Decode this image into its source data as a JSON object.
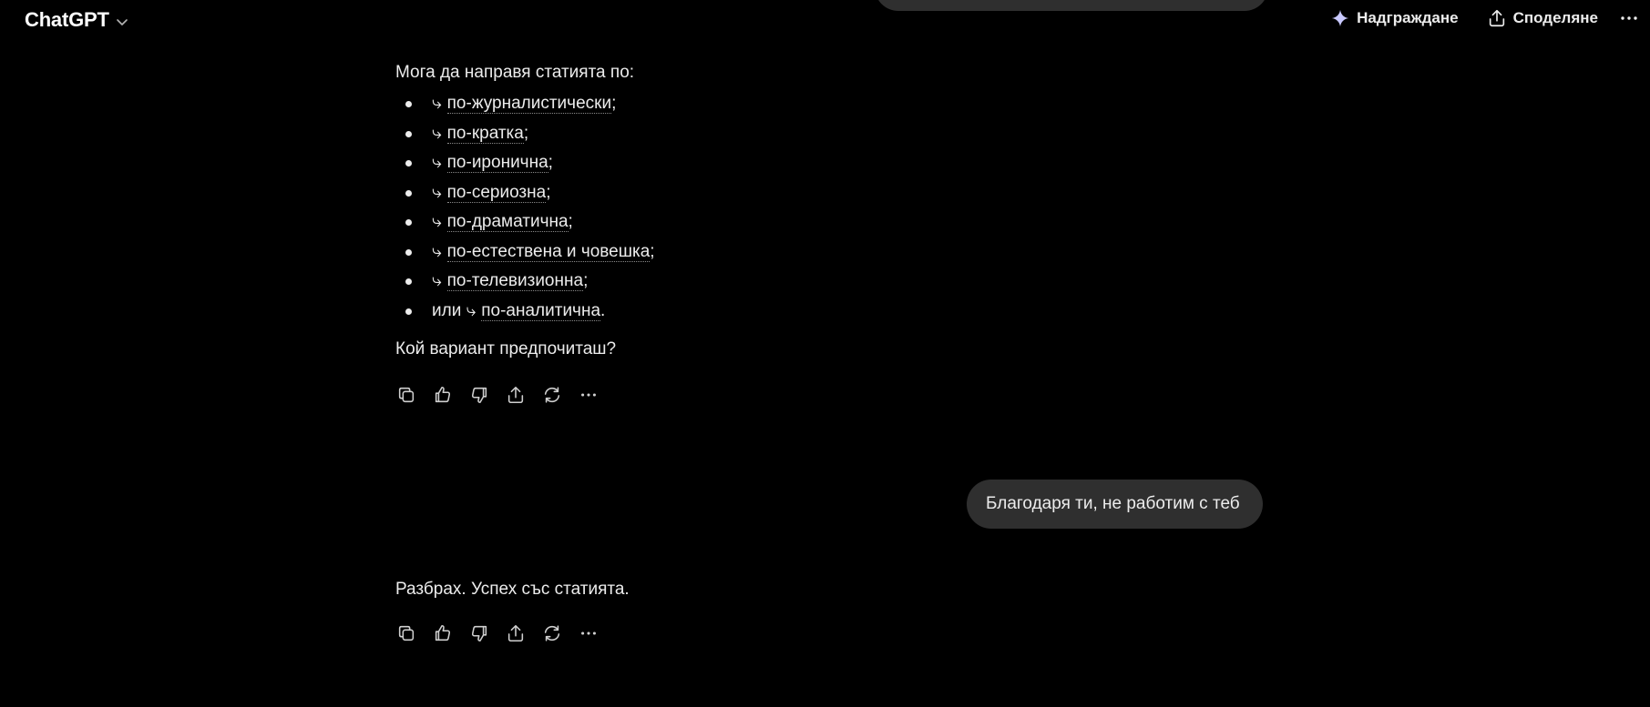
{
  "header": {
    "model_name": "ChatGPT",
    "upgrade_label": "Надграждане",
    "share_label": "Споделяне"
  },
  "conversation": {
    "assistant_message_1": {
      "intro": "Мога да направя статията по:",
      "options": [
        {
          "prefix": "",
          "arrow": "⤷",
          "link": "по-журналистически",
          "suffix": ";"
        },
        {
          "prefix": "",
          "arrow": "⤷",
          "link": "по-кратка",
          "suffix": ";"
        },
        {
          "prefix": "",
          "arrow": "⤷",
          "link": "по-иронична",
          "suffix": ";"
        },
        {
          "prefix": "",
          "arrow": "⤷",
          "link": "по-сериозна",
          "suffix": ";"
        },
        {
          "prefix": "",
          "arrow": "⤷",
          "link": "по-драматична",
          "suffix": ";"
        },
        {
          "prefix": "",
          "arrow": "⤷",
          "link": "по-естествена и човешка",
          "suffix": ";"
        },
        {
          "prefix": "",
          "arrow": "⤷",
          "link": "по-телевизионна",
          "suffix": ";"
        },
        {
          "prefix": "или ",
          "arrow": "⤷",
          "link": "по-аналитична",
          "suffix": "."
        }
      ],
      "question": "Кой вариант предпочиташ?"
    },
    "user_message": "Благодаря ти, не работим с теб",
    "assistant_message_2": "Разбрах. Успех със статията."
  },
  "message_actions": [
    "copy-icon",
    "thumbs-up-icon",
    "thumbs-down-icon",
    "share-icon",
    "regenerate-icon",
    "more-icon"
  ],
  "colors": {
    "background": "#000000",
    "text": "#ececec",
    "bubble": "#2f2f2f"
  }
}
